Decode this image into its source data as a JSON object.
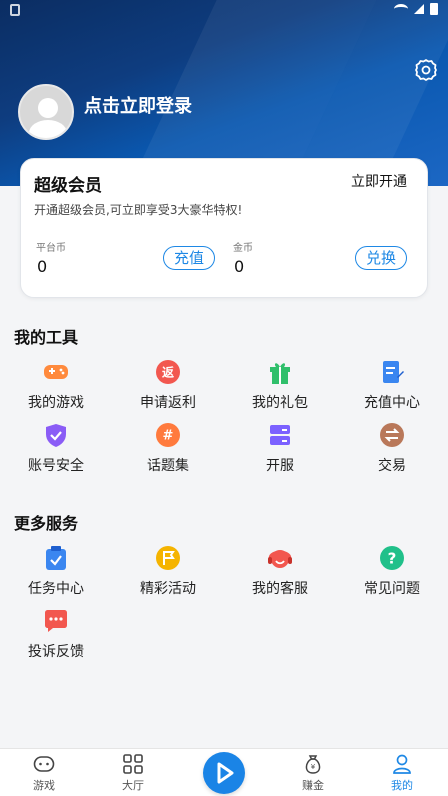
{
  "header": {
    "login_text": "点击立即登录"
  },
  "vip": {
    "title": "超级会员",
    "open_label": "立即开通",
    "description": "开通超级会员,可立即享受3大豪华特权!",
    "platform_coin_label": "平台币",
    "platform_coin_value": "0",
    "recharge_label": "充值",
    "gold_label": "金币",
    "gold_value": "0",
    "exchange_label": "兑换"
  },
  "tools": {
    "title": "我的工具",
    "items": [
      {
        "label": "我的游戏",
        "icon": "gamepad-icon",
        "color": "#ff8a3d"
      },
      {
        "label": "申请返利",
        "icon": "rebate-icon",
        "color": "#f2574f"
      },
      {
        "label": "我的礼包",
        "icon": "gift-icon",
        "color": "#2fbf6b"
      },
      {
        "label": "充值中心",
        "icon": "recharge-doc-icon",
        "color": "#3a86f0"
      },
      {
        "label": "账号安全",
        "icon": "shield-icon",
        "color": "#8a5cf6"
      },
      {
        "label": "话题集",
        "icon": "hashtag-icon",
        "color": "#ff7a3d"
      },
      {
        "label": "开服",
        "icon": "server-icon",
        "color": "#7b61ff"
      },
      {
        "label": "交易",
        "icon": "trade-icon",
        "color": "#b9785a"
      }
    ]
  },
  "services": {
    "title": "更多服务",
    "items": [
      {
        "label": "任务中心",
        "icon": "task-clipboard-icon",
        "color": "#3a86f0"
      },
      {
        "label": "精彩活动",
        "icon": "flag-icon",
        "color": "#f5b400"
      },
      {
        "label": "我的客服",
        "icon": "customer-service-icon",
        "color": "#f2574f"
      },
      {
        "label": "常见问题",
        "icon": "question-icon",
        "color": "#20c08a"
      },
      {
        "label": "投诉反馈",
        "icon": "feedback-icon",
        "color": "#f2574f"
      }
    ]
  },
  "nav": {
    "games": "游戏",
    "hall": "大厅",
    "earn": "赚金",
    "mine": "我的"
  },
  "colors": {
    "accent": "#1e88e5",
    "header_dark": "#0b2d62"
  }
}
